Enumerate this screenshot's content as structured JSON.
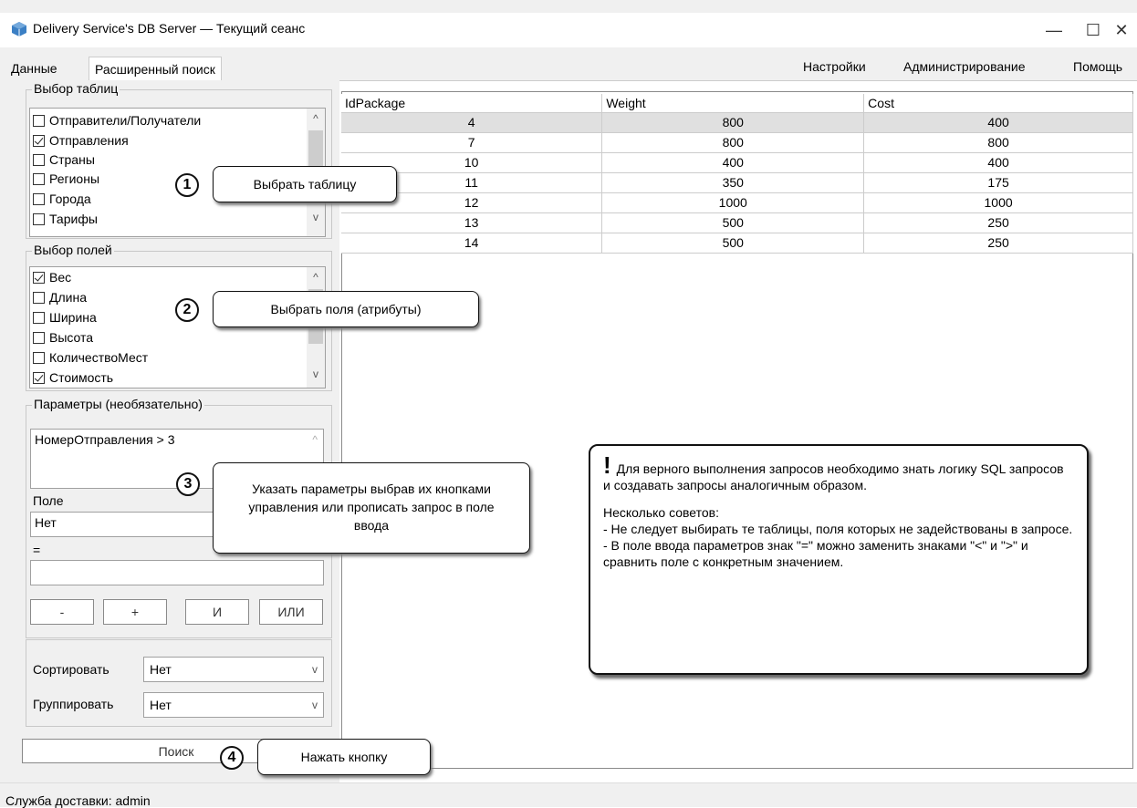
{
  "window": {
    "title": "Delivery Service's DB Server — Текущий сеанс"
  },
  "tabs": [
    "Данные",
    "Расширенный поиск"
  ],
  "menu": [
    "Настройки",
    "Администрирование",
    "Помощь"
  ],
  "tables_group": {
    "legend": "Выбор таблиц",
    "items": [
      {
        "label": "Отправители/Получатели",
        "checked": false
      },
      {
        "label": "Отправления",
        "checked": true
      },
      {
        "label": "Страны",
        "checked": false
      },
      {
        "label": "Регионы",
        "checked": false
      },
      {
        "label": "Города",
        "checked": false
      },
      {
        "label": "Тарифы",
        "checked": false
      }
    ]
  },
  "fields_group": {
    "legend": "Выбор полей",
    "items": [
      {
        "label": "Вес",
        "checked": true
      },
      {
        "label": "Длина",
        "checked": false
      },
      {
        "label": "Ширина",
        "checked": false
      },
      {
        "label": "Высота",
        "checked": false
      },
      {
        "label": "КоличествоМест",
        "checked": false
      },
      {
        "label": "Стоимость",
        "checked": true
      }
    ]
  },
  "params_group": {
    "legend": "Параметры (необязательно)",
    "query_text": "НомерОтправления > 3",
    "field_label": "Поле",
    "field_value": "Нет",
    "eq_label": "=",
    "value_input": "",
    "buttons": [
      "-",
      "+",
      "И",
      "ИЛИ"
    ]
  },
  "sort": {
    "label": "Сортировать",
    "value": "Нет"
  },
  "group": {
    "label": "Группировать",
    "value": "Нет"
  },
  "search_button": "Поиск",
  "grid": {
    "columns": [
      "IdPackage",
      "Weight",
      "Cost"
    ],
    "rows": [
      [
        "4",
        "800",
        "400"
      ],
      [
        "7",
        "800",
        "800"
      ],
      [
        "10",
        "400",
        "400"
      ],
      [
        "11",
        "350",
        "175"
      ],
      [
        "12",
        "1000",
        "1000"
      ],
      [
        "13",
        "500",
        "250"
      ],
      [
        "14",
        "500",
        "250"
      ]
    ]
  },
  "callouts": {
    "c1": {
      "num": "1",
      "text": "Выбрать таблицу"
    },
    "c2": {
      "num": "2",
      "text": "Выбрать поля (атрибуты)"
    },
    "c3": {
      "num": "3",
      "text": "Указать параметры выбрав их кнопками управления или прописать запрос в поле ввода"
    },
    "c4": {
      "num": "4",
      "text": "Нажать кнопку"
    }
  },
  "note": {
    "bang": "!",
    "line1": "Для верного выполнения запросов необходимо знать логику SQL запросов и создавать запросы аналогичным образом.",
    "tips_title": "Несколько советов:",
    "tip1": "- Не следует выбирать те таблицы, поля которых не задействованы в запросе.",
    "tip2": "- В поле ввода параметров знак \"=\" можно заменить знаками \"<\" и \">\" и сравнить поле с конкретным значением."
  },
  "status": "Служба доставки: admin"
}
